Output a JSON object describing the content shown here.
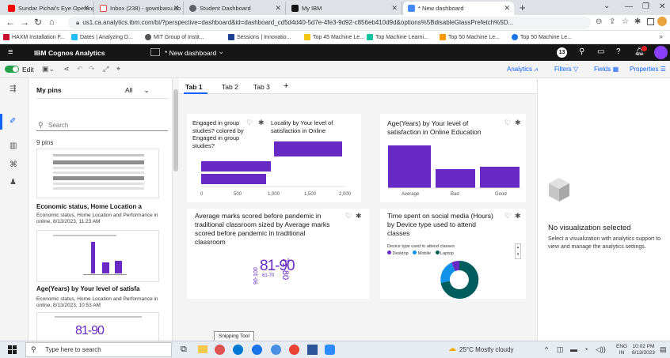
{
  "browser": {
    "tabs": [
      {
        "label": "Sundar Pichai's Eye Opening",
        "color": "#ff0000"
      },
      {
        "label": "Inbox (238) - gowribasu.db",
        "color": "#ea4335"
      },
      {
        "label": "Student Dashboard",
        "color": "#5f6368"
      },
      {
        "label": "My IBM",
        "color": "#161616"
      },
      {
        "label": "* New dashboard",
        "color": "#4589ff"
      }
    ],
    "new_tab": "+",
    "url": "us1.ca.analytics.ibm.com/bi/?perspective=dashboard&id=dashboard_cd5d4d40-5d7e-4fe3-9d92-c856eb410d9d&options%5BdisableGlassPrefetch%5D...",
    "bookmarks": [
      {
        "label": "HAXM Installation F...",
        "color": "#c8102e"
      },
      {
        "label": "Dates | Analyzing D...",
        "color": "#20beff"
      },
      {
        "label": "MIT Group of Instit...",
        "color": "#555555"
      },
      {
        "label": "Sessions | Innovatio...",
        "color": "#1d3f91"
      },
      {
        "label": "Top 45 Machine Le...",
        "color": "#f5c518"
      },
      {
        "label": "Top Machine Learni...",
        "color": "#13c4a3"
      },
      {
        "label": "Top 50 Machine Le...",
        "color": "#ff9900"
      },
      {
        "label": "Top 50 Machine Le...",
        "color": "#1a73e8"
      }
    ]
  },
  "ibm": {
    "product": "IBM Cognos Analytics",
    "dashboard_title": "* New dashboard",
    "notif_count": "13",
    "toolbar": {
      "edit": "Edit",
      "analytics": "Analytics",
      "filters": "Filters",
      "fields": "Fields",
      "properties": "Properties"
    }
  },
  "pins": {
    "title": "My pins",
    "filter": "All",
    "search_placeholder": "Search",
    "count": "9 pins",
    "items": [
      {
        "title": "Economic status, Home Location a",
        "desc": "Economic status, Home Location and Performance in online, 8/13/2023, 11:23 AM"
      },
      {
        "title": "Age(Years) by Your level of satisfa",
        "desc": "Economic status, Home Location and Performance in online, 8/13/2023, 10:53 AM"
      }
    ],
    "thumb3_text": "81-90"
  },
  "canvas": {
    "tabs": [
      "Tab 1",
      "Tab 2",
      "Tab 3"
    ],
    "add_tab": "+",
    "card1": {
      "title": "Engaged in group studies? colored by Engaged in group studies?",
      "overlap_title": "Locality by Your level of satisfaction in Online Education",
      "ticks": [
        "0",
        "500",
        "1,000",
        "1,500",
        "2,000"
      ]
    },
    "card2": {
      "title": "Age(Years) by Your level of satisfaction in Online Education",
      "categories": [
        "Average",
        "Bad",
        "Good"
      ]
    },
    "card3": {
      "title": "Average marks scored before pandemic in traditional classroom sized by Average marks scored before pandemic in traditional classroom",
      "words": [
        "81-90",
        "71-80",
        "61-70",
        "90-100"
      ]
    },
    "card4": {
      "title": "Time spent on social media (Hours) by Device type used to attend classes",
      "legend_title": "Device type used to attend classes",
      "legend": [
        {
          "label": "Desktop",
          "color": "#6929c4"
        },
        {
          "label": "Mobile",
          "color": "#1192e8"
        },
        {
          "label": "Laptop",
          "color": "#005d5d"
        }
      ]
    }
  },
  "right_panel": {
    "heading": "No visualization selected",
    "body": "Select a visualization with analytics support to view and manage the analytics settings."
  },
  "tooltip": "Snipping Tool",
  "taskbar": {
    "search_placeholder": "Type here to search",
    "weather": "25°C  Mostly cloudy",
    "lang1": "ENG",
    "lang2": "IN",
    "time": "10:02 PM",
    "date": "8/13/2023"
  },
  "colors": {
    "accent": "#6929c4",
    "ibm_blue": "#0f62fe",
    "dark_bar": "#161616"
  }
}
